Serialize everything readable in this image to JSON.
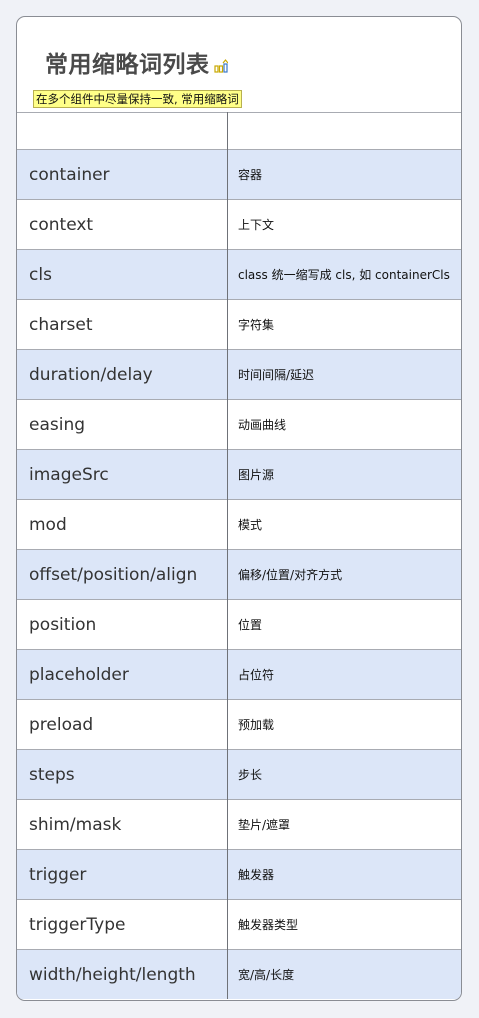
{
  "title": "常用缩略词列表",
  "title_icon": "chart-icon",
  "note": "在多个组件中尽量保持一致, 常用缩略词",
  "colors": {
    "alt_row": "#dce6f8",
    "note_bg": "#ffff88",
    "page_bg": "#f0f2f7"
  },
  "rows": [
    {
      "key": "container",
      "value": "容器"
    },
    {
      "key": "context",
      "value": "上下文"
    },
    {
      "key": "cls",
      "value": "class 统一缩写成 cls, 如 containerCls"
    },
    {
      "key": "charset",
      "value": "字符集"
    },
    {
      "key": "duration/delay",
      "value": "时间间隔/延迟"
    },
    {
      "key": "easing",
      "value": "动画曲线"
    },
    {
      "key": "imageSrc",
      "value": "图片源"
    },
    {
      "key": "mod",
      "value": "模式"
    },
    {
      "key": "offset/position/align",
      "value": "偏移/位置/对齐方式"
    },
    {
      "key": "position",
      "value": "位置"
    },
    {
      "key": "placeholder",
      "value": "占位符"
    },
    {
      "key": "preload",
      "value": "预加载"
    },
    {
      "key": "steps",
      "value": "步长"
    },
    {
      "key": "shim/mask",
      "value": "垫片/遮罩"
    },
    {
      "key": "trigger",
      "value": "触发器"
    },
    {
      "key": "triggerType",
      "value": "触发器类型"
    },
    {
      "key": "width/height/length",
      "value": "宽/高/长度"
    }
  ]
}
